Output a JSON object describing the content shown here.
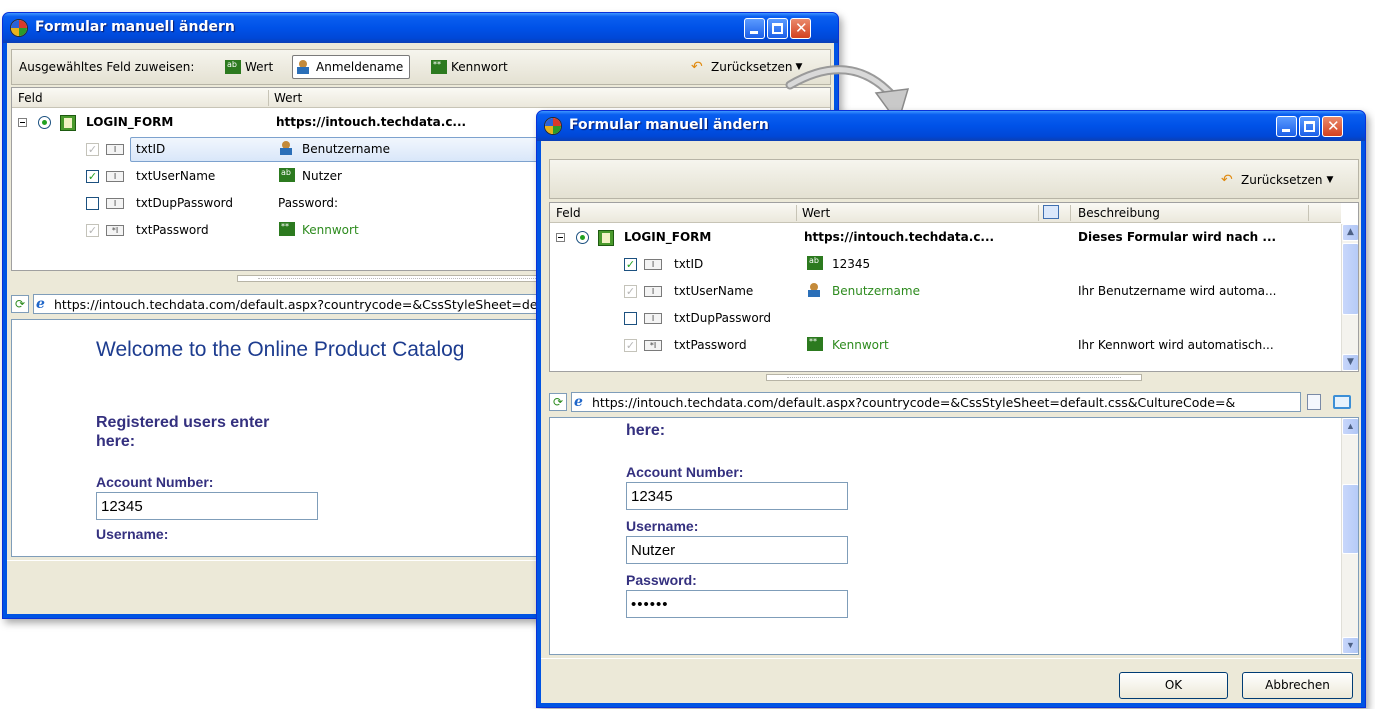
{
  "window1": {
    "title": "Formular manuell ändern",
    "toolbar": {
      "assign_label": "Ausgewähltes Feld zuweisen:",
      "wert": "Wert",
      "anmeldename": "Anmeldename",
      "kennwort": "Kennwort",
      "reset": "Zurücksetzen"
    },
    "grid": {
      "col_feld": "Feld",
      "col_wert": "Wert",
      "form": {
        "name": "LOGIN_FORM",
        "value": "https://intouch.techdata.c..."
      },
      "rows": [
        {
          "name": "txtID",
          "value": "Benutzername"
        },
        {
          "name": "txtUserName",
          "value": "Nutzer"
        },
        {
          "name": "txtDupPassword",
          "value": "Password:"
        },
        {
          "name": "txtPassword",
          "value": "Kennwort"
        }
      ]
    },
    "url": "https://intouch.techdata.com/default.aspx?countrycode=&CssStyleSheet=default.css&CultureCode=",
    "web": {
      "welcome": "Welcome to the Online Product Catalog",
      "registered_1": "Registered users enter",
      "registered_2": "here:",
      "account_label": "Account Number:",
      "account_value": "12345",
      "username_partial": "Username:"
    }
  },
  "window2": {
    "title": "Formular manuell ändern",
    "toolbar": {
      "reset": "Zurücksetzen"
    },
    "grid": {
      "col_feld": "Feld",
      "col_wert": "Wert",
      "col_beschreibung": "Beschreibung",
      "form": {
        "name": "LOGIN_FORM",
        "value": "https://intouch.techdata.c...",
        "desc": "Dieses Formular wird nach ..."
      },
      "rows": [
        {
          "name": "txtID",
          "value": "12345",
          "desc": ""
        },
        {
          "name": "txtUserName",
          "value": "Benutzername",
          "desc": "Ihr Benutzername wird automa..."
        },
        {
          "name": "txtDupPassword",
          "value": "",
          "desc": ""
        },
        {
          "name": "txtPassword",
          "value": "Kennwort",
          "desc": "Ihr Kennwort wird automatisch..."
        }
      ]
    },
    "url": "https://intouch.techdata.com/default.aspx?countrycode=&CssStyleSheet=default.css&CultureCode=&",
    "web": {
      "here": "here:",
      "account_label": "Account Number:",
      "account_value": "12345",
      "username_label": "Username:",
      "username_value": "Nutzer",
      "password_label": "Password:",
      "password_value": "••••••"
    },
    "buttons": {
      "ok": "OK",
      "cancel": "Abbrechen"
    }
  },
  "colors": {
    "xp_blue": "#0054e3",
    "green_text": "#2d8b1e",
    "web_label": "#34307f"
  }
}
